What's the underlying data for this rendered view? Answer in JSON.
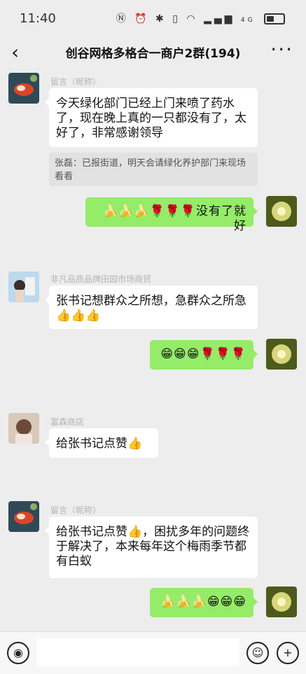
{
  "status_bar": {
    "time": "11:40",
    "icons": [
      "nfc-icon",
      "alarm-icon",
      "bluetooth-icon",
      "vibrate-icon",
      "wifi-icon",
      "signal-icon",
      "battery-icon"
    ],
    "network": "4G"
  },
  "header": {
    "title": "创谷网格多格合一商户2群(194)"
  },
  "messages": [
    {
      "side": "left",
      "sender": "留言（昵称）",
      "text": "今天绿化部门已经上门来喷了药水了，现在晚上真的一只都没有了，太好了，非常感谢领导",
      "quote": "张磊：已报街道，明天会请绿化养护部门来现场看看"
    },
    {
      "side": "right",
      "text": "🍌🍌🍌🌹🌹🌹没有了就好"
    },
    {
      "side": "left",
      "sender": "非凡品质品牌田园市场商贸",
      "text": "张书记想群众之所想，急群众之所急👍👍👍"
    },
    {
      "side": "right",
      "text": "😁😁😁🌹🌹🌹"
    },
    {
      "side": "left",
      "sender": "富森商店",
      "text": "给张书记点赞👍"
    },
    {
      "side": "left",
      "sender": "留言（昵称）",
      "text": "给张书记点赞👍，困扰多年的问题终于解决了，本来每年这个梅雨季节都有白蚁"
    },
    {
      "side": "right",
      "text": "🍌🍌🍌😁😁😁"
    }
  ],
  "input_bar": {
    "voice_icon": "voice-icon",
    "emoji_icon": "emoji-icon",
    "plus_icon": "plus-icon"
  },
  "colors": {
    "background": "#ededed",
    "bubble_self": "#95ec69",
    "bubble_other": "#ffffff"
  }
}
